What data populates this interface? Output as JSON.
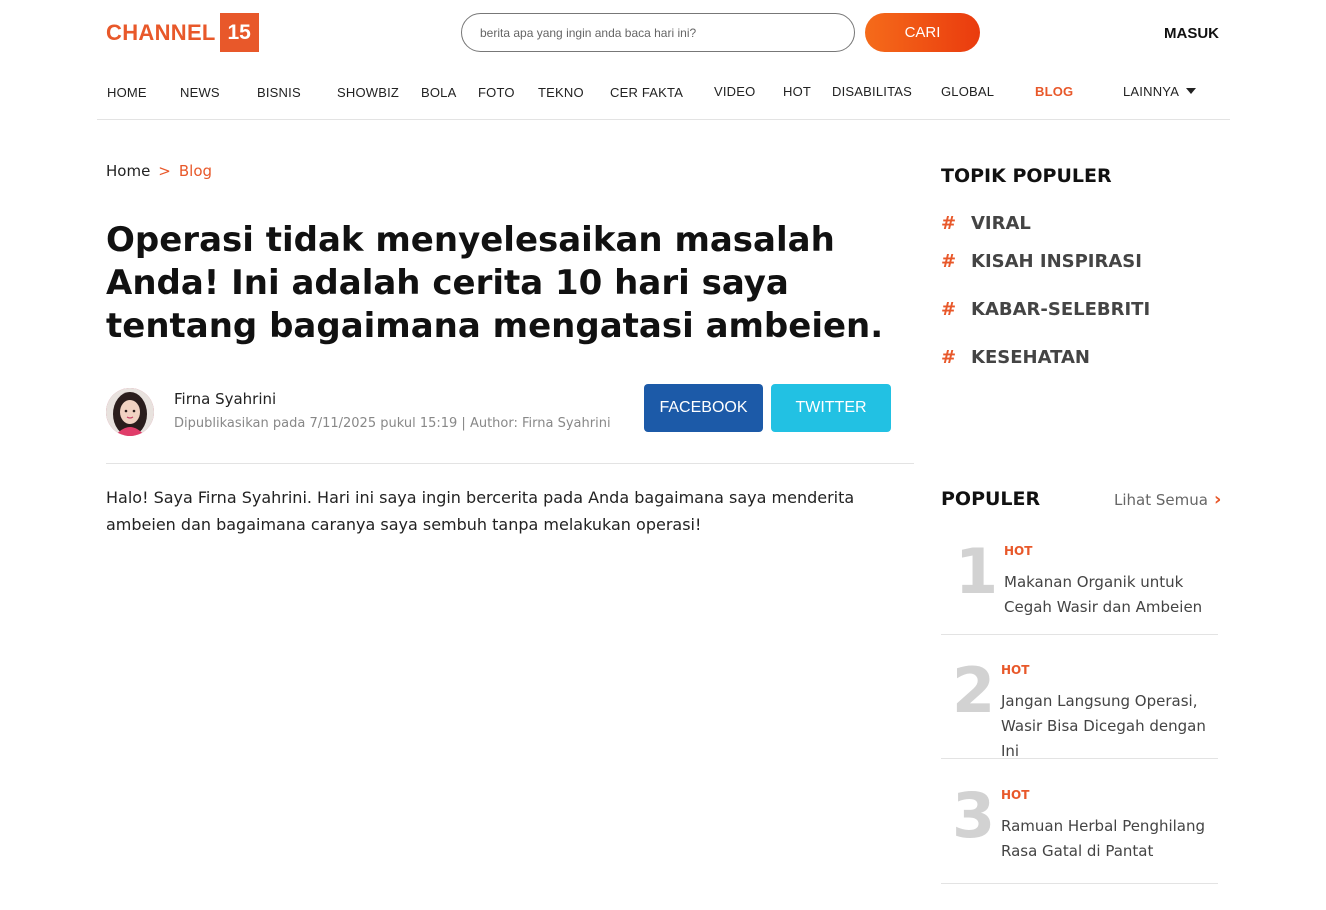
{
  "header": {
    "logo_text": "CHANNEL",
    "logo_number": "15",
    "search_placeholder": "berita apa yang ingin anda baca hari ini?",
    "search_button": "CARI",
    "login": "MASUK"
  },
  "nav": {
    "items": [
      "HOME",
      "NEWS",
      "BISNIS",
      "SHOWBIZ",
      "BOLA",
      "FOTO",
      "TEKNO",
      "CER FAKTA",
      "VIDEO",
      "HOT",
      "DISABILITAS",
      "GLOBAL",
      "BLOG",
      "LAINNYA"
    ],
    "active": "BLOG"
  },
  "breadcrumb": {
    "home": "Home",
    "separator": ">",
    "current": "Blog"
  },
  "article": {
    "title": "Operasi tidak menyelesaikan masalah Anda! Ini adalah cerita 10 hari saya tentang bagaimana mengatasi ambeien.",
    "author": "Firna Syahrini",
    "meta": "Dipublikasikan pada 7/11/2025 pukul 15:19 | Author: Firna Syahrini",
    "body": "Halo! Saya Firna Syahrini. Hari ini saya ingin bercerita pada Anda bagaimana saya menderita ambeien dan bagaimana caranya saya sembuh tanpa melakukan operasi!"
  },
  "share": {
    "facebook": "FACEBOOK",
    "twitter": "TWITTER"
  },
  "sidebar": {
    "topik_heading": "TOPIK POPULER",
    "hash": "#",
    "topics": [
      "VIRAL",
      "KISAH INSPIRASI",
      "KABAR-SELEBRITI",
      "KESEHATAN"
    ],
    "populer_heading": "POPULER",
    "see_all": "Lihat Semua",
    "popular": [
      {
        "rank": "1",
        "tag": "HOT",
        "title": "Makanan Organik untuk Cegah Wasir dan Ambeien"
      },
      {
        "rank": "2",
        "tag": "HOT",
        "title": "Jangan Langsung Operasi, Wasir Bisa Dicegah dengan Ini"
      },
      {
        "rank": "3",
        "tag": "HOT",
        "title": "Ramuan Herbal Penghilang Rasa Gatal di Pantat"
      }
    ]
  },
  "colors": {
    "accent": "#e8582a",
    "facebook": "#1c5aa8",
    "twitter": "#22c1e3"
  }
}
